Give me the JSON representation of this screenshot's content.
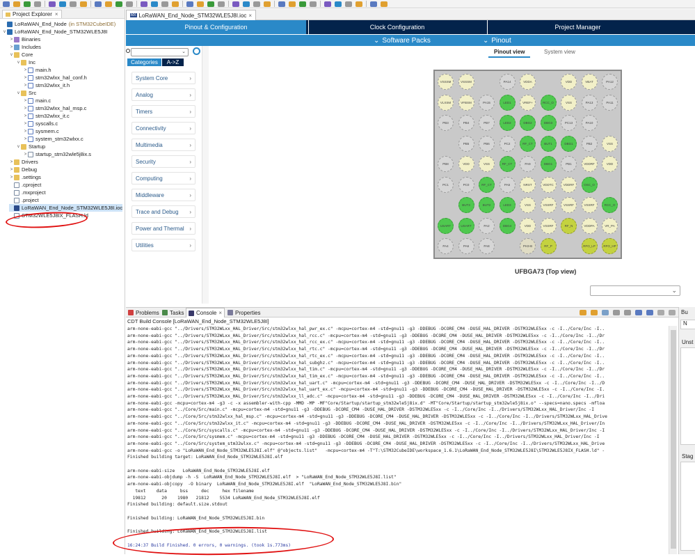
{
  "explorer": {
    "title": "Project Explorer",
    "tree": [
      {
        "label": "LoRaWAN_End_Node",
        "suffix": "(in STM32CubeIDE)",
        "icon": "project-icon",
        "twisty": "",
        "depth": 0
      },
      {
        "label": "LoRaWAN_End_Node_STM32WLE5J8I",
        "icon": "project-icon",
        "twisty": "v",
        "depth": 0
      },
      {
        "label": "Binaries",
        "icon": "binaries-icon",
        "twisty": ">",
        "depth": 1
      },
      {
        "label": "Includes",
        "icon": "includes-icon",
        "twisty": ">",
        "depth": 1
      },
      {
        "label": "Core",
        "icon": "folder-icon",
        "twisty": "v",
        "depth": 1
      },
      {
        "label": "Inc",
        "icon": "folder-icon",
        "twisty": "v",
        "depth": 2
      },
      {
        "label": "main.h",
        "icon": "header-file-icon",
        "twisty": ">",
        "depth": 3
      },
      {
        "label": "stm32wlxx_hal_conf.h",
        "icon": "header-file-icon",
        "twisty": ">",
        "depth": 3
      },
      {
        "label": "stm32wlxx_it.h",
        "icon": "header-file-icon",
        "twisty": ">",
        "depth": 3
      },
      {
        "label": "Src",
        "icon": "folder-icon",
        "twisty": "v",
        "depth": 2
      },
      {
        "label": "main.c",
        "icon": "c-file-icon",
        "twisty": ">",
        "depth": 3
      },
      {
        "label": "stm32wlxx_hal_msp.c",
        "icon": "c-file-icon",
        "twisty": ">",
        "depth": 3
      },
      {
        "label": "stm32wlxx_it.c",
        "icon": "c-file-icon",
        "twisty": ">",
        "depth": 3
      },
      {
        "label": "syscalls.c",
        "icon": "c-file-icon",
        "twisty": ">",
        "depth": 3
      },
      {
        "label": "sysmem.c",
        "icon": "c-file-icon",
        "twisty": ">",
        "depth": 3
      },
      {
        "label": "system_stm32wlxx.c",
        "icon": "c-file-icon",
        "twisty": ">",
        "depth": 3
      },
      {
        "label": "Startup",
        "icon": "folder-icon",
        "twisty": "v",
        "depth": 2
      },
      {
        "label": "startup_stm32wle5j8ix.s",
        "icon": "asm-file-icon",
        "twisty": ">",
        "depth": 3
      },
      {
        "label": "Drivers",
        "icon": "folder-icon",
        "twisty": ">",
        "depth": 1
      },
      {
        "label": "Debug",
        "icon": "folder-icon",
        "twisty": ">",
        "depth": 1
      },
      {
        "label": ".settings",
        "icon": "folder-icon",
        "twisty": ">",
        "depth": 1
      },
      {
        "label": ".cproject",
        "icon": "file-icon",
        "twisty": "",
        "depth": 1
      },
      {
        "label": ".mxproject",
        "icon": "file-icon",
        "twisty": "",
        "depth": 1
      },
      {
        "label": ".project",
        "icon": "file-icon",
        "twisty": "",
        "depth": 1
      },
      {
        "label": "LoRaWAN_End_Node_STM32WLE5J8I.ioc",
        "icon": "ioc-file-icon",
        "twisty": "",
        "depth": 1,
        "selected": true
      },
      {
        "label": "STM32WLE5J8IX_FLASH.ld",
        "icon": "file-icon",
        "twisty": "",
        "depth": 1
      }
    ]
  },
  "editor": {
    "tab_label": "LoRaWAN_End_Node_STM32WLE5J8I.ioc",
    "tab_badge": "MX",
    "nav": [
      "Pinout & Configuration",
      "Clock Configuration",
      "Project Manager"
    ],
    "subnav": [
      "Software Packs",
      "Pinout"
    ],
    "subnav_chevron": "⌄",
    "categories_tab": "Categories",
    "az_tab": "A->Z",
    "categories": [
      "System Core",
      "Analog",
      "Timers",
      "Connectivity",
      "Multimedia",
      "Security",
      "Computing",
      "Middleware",
      "Trace and Debug",
      "Power and Thermal",
      "Utilities"
    ],
    "view_tabs": [
      "Pinout view",
      "System view"
    ],
    "chip_label": "UFBGA73 (Top view)"
  },
  "chip_pins": [
    [
      "VSSSM",
      "VSSSM",
      "",
      "PA14",
      "VDDA",
      "",
      "VDD",
      "VBAT",
      "PA12"
    ],
    [
      "VLXSM",
      "VFBSM",
      "PA15",
      "LED1",
      "VREF+",
      "RCC_O",
      "VSS",
      "PA13",
      "PA11"
    ],
    [
      "PB3",
      "PB4",
      "PB7",
      "LED2",
      "DBG2",
      "DBG3",
      "PC13",
      "PA10",
      ""
    ],
    [
      "",
      "PB5",
      "PB6",
      "PC2",
      "RF_CT",
      "BUT1",
      "DBG1",
      "PB2",
      "VSS"
    ],
    [
      "PB8",
      "VDD",
      "VSS",
      "RF_CT",
      "PA9",
      "DBG1",
      "PB1",
      "VDDRF",
      "VDD"
    ],
    [
      "PC1",
      "PC0",
      "RF_CT",
      "PA5",
      "NRST",
      "VDDTC",
      "VDDRF",
      "OSC_O",
      ""
    ],
    [
      "",
      "BUT3",
      "BUT2",
      "LED3",
      "VSS",
      "VSSRF",
      "VSSRF",
      "VSSRF",
      "RCC_O"
    ],
    [
      "USART",
      "USART",
      "PA2",
      "DBG4",
      "VDD",
      "VSSRF",
      "RF_N",
      "VDDPA",
      "VR_PA"
    ],
    [
      "PA4",
      "PA6",
      "PA8",
      "",
      "PH3-B",
      "RF_P",
      "",
      "RFO_LP",
      "RFO_HP"
    ]
  ],
  "chip_pin_types": [
    [
      "pwr",
      "pwr",
      "none",
      "gray",
      "pwr",
      "none",
      "pwr",
      "pwr",
      "gray"
    ],
    [
      "pwr",
      "pwr",
      "gray",
      "green",
      "pwr",
      "green",
      "pwr",
      "gray",
      "gray"
    ],
    [
      "gray",
      "gray",
      "gray",
      "green",
      "green",
      "green",
      "gray",
      "gray",
      "none"
    ],
    [
      "none",
      "gray",
      "gray",
      "gray",
      "green",
      "green",
      "green",
      "gray",
      "pwr"
    ],
    [
      "gray",
      "pwr",
      "pwr",
      "green",
      "gray",
      "green",
      "gray",
      "pwr",
      "pwr"
    ],
    [
      "gray",
      "gray",
      "green",
      "gray",
      "pwr",
      "pwr",
      "pwr",
      "green",
      "none"
    ],
    [
      "none",
      "green",
      "green",
      "green",
      "pwr",
      "pwr",
      "pwr",
      "pwr",
      "green"
    ],
    [
      "green",
      "green",
      "gray",
      "green",
      "pwr",
      "pwr",
      "olive",
      "pwr",
      "pwr"
    ],
    [
      "gray",
      "gray",
      "gray",
      "none",
      "pinkish",
      "olive",
      "none",
      "olive",
      "olive"
    ]
  ],
  "bottom": {
    "tabs": [
      "Problems",
      "Tasks",
      "Console",
      "Properties"
    ],
    "console_title": "CDT Build Console [LoRaWAN_End_Node_STM32WLE5J8I]",
    "lines": [
      "arm-none-eabi-gcc \"../Drivers/STM32WLxx_HAL_Driver/Src/stm32wlxx_hal_pwr_ex.c\" -mcpu=cortex-m4 -std=gnu11 -g3 -DDEBUG -DCORE_CM4 -DUSE_HAL_DRIVER -DSTM32WLE5xx -c -I../Core/Inc -I..",
      "arm-none-eabi-gcc \"../Drivers/STM32WLxx_HAL_Driver/Src/stm32wlxx_hal_rcc.c\" -mcpu=cortex-m4 -std=gnu11 -g3 -DDEBUG -DCORE_CM4 -DUSE_HAL_DRIVER -DSTM32WLE5xx -c -I../Core/Inc -I../Dr",
      "arm-none-eabi-gcc \"../Drivers/STM32WLxx_HAL_Driver/Src/stm32wlxx_hal_rcc_ex.c\" -mcpu=cortex-m4 -std=gnu11 -g3 -DDEBUG -DCORE_CM4 -DUSE_HAL_DRIVER -DSTM32WLE5xx -c -I../Core/Inc -I..",
      "arm-none-eabi-gcc \"../Drivers/STM32WLxx_HAL_Driver/Src/stm32wlxx_hal_rtc.c\" -mcpu=cortex-m4 -std=gnu11 -g3 -DDEBUG -DCORE_CM4 -DUSE_HAL_DRIVER -DSTM32WLE5xx -c -I../Core/Inc -I../Dr",
      "arm-none-eabi-gcc \"../Drivers/STM32WLxx_HAL_Driver/Src/stm32wlxx_hal_rtc_ex.c\" -mcpu=cortex-m4 -std=gnu11 -g3 -DDEBUG -DCORE_CM4 -DUSE_HAL_DRIVER -DSTM32WLE5xx -c -I../Core/Inc -I..",
      "arm-none-eabi-gcc \"../Drivers/STM32WLxx_HAL_Driver/Src/stm32wlxx_hal_subghz.c\" -mcpu=cortex-m4 -std=gnu11 -g3 -DDEBUG -DCORE_CM4 -DUSE_HAL_DRIVER -DSTM32WLE5xx -c -I../Core/Inc -I..",
      "arm-none-eabi-gcc \"../Drivers/STM32WLxx_HAL_Driver/Src/stm32wlxx_hal_tim.c\" -mcpu=cortex-m4 -std=gnu11 -g3 -DDEBUG -DCORE_CM4 -DUSE_HAL_DRIVER -DSTM32WLE5xx -c -I../Core/Inc -I../Dr",
      "arm-none-eabi-gcc \"../Drivers/STM32WLxx_HAL_Driver/Src/stm32wlxx_hal_tim_ex.c\" -mcpu=cortex-m4 -std=gnu11 -g3 -DDEBUG -DCORE_CM4 -DUSE_HAL_DRIVER -DSTM32WLE5xx -c -I../Core/Inc -I..",
      "arm-none-eabi-gcc \"../Drivers/STM32WLxx_HAL_Driver/Src/stm32wlxx_hal_uart.c\" -mcpu=cortex-m4 -std=gnu11 -g3 -DDEBUG -DCORE_CM4 -DUSE_HAL_DRIVER -DSTM32WLE5xx -c -I../Core/Inc -I../D",
      "arm-none-eabi-gcc \"../Drivers/STM32WLxx_HAL_Driver/Src/stm32wlxx_hal_uart_ex.c\" -mcpu=cortex-m4 -std=gnu11 -g3 -DDEBUG -DCORE_CM4 -DUSE_HAL_DRIVER -DSTM32WLE5xx -c -I../Core/Inc -I.",
      "arm-none-eabi-gcc \"../Drivers/STM32WLxx_HAL_Driver/Src/stm32wlxx_ll_adc.c\" -mcpu=cortex-m4 -std=gnu11 -g3 -DDEBUG -DCORE_CM4 -DUSE_HAL_DRIVER -DSTM32WLE5xx -c -I../Core/Inc -I../Dri",
      "arm-none-eabi-gcc -mcpu=cortex-m4 -g3 -c -x assembler-with-cpp -MMD -MP -MF\"Core/Startup/startup_stm32wle5j8ix.d\" -MT\"Core/Startup/startup_stm32wle5j8ix.o\" --specs=nano.specs -mfloa",
      "arm-none-eabi-gcc \"../Core/Src/main.c\" -mcpu=cortex-m4 -std=gnu11 -g3 -DDEBUG -DCORE_CM4 -DUSE_HAL_DRIVER -DSTM32WLE5xx -c -I../Core/Inc -I../Drivers/STM32WLxx_HAL_Driver/Inc -I",
      "arm-none-eabi-gcc \"../Core/Src/stm32wlxx_hal_msp.c\" -mcpu=cortex-m4 -std=gnu11 -g3 -DDEBUG -DCORE_CM4 -DUSE_HAL_DRIVER -DSTM32WLE5xx -c -I../Core/Inc -I../Drivers/STM32WLxx_HAL_Drive",
      "arm-none-eabi-gcc \"../Core/Src/stm32wlxx_it.c\" -mcpu=cortex-m4 -std=gnu11 -g3 -DDEBUG -DCORE_CM4 -DUSE_HAL_DRIVER -DSTM32WLE5xx -c -I../Core/Inc -I../Drivers/STM32WLxx_HAL_Driver/In",
      "arm-none-eabi-gcc \"../Core/Src/syscalls.c\" -mcpu=cortex-m4 -std=gnu11 -g3 -DDEBUG -DCORE_CM4 -DUSE_HAL_DRIVER -DSTM32WLE5xx -c -I../Core/Inc -I../Drivers/STM32WLxx_HAL_Driver/Inc -I",
      "arm-none-eabi-gcc \"../Core/Src/sysmem.c\" -mcpu=cortex-m4 -std=gnu11 -g3 -DDEBUG -DCORE_CM4 -DUSE_HAL_DRIVER -DSTM32WLE5xx -c -I../Core/Inc -I../Drivers/STM32WLxx_HAL_Driver/Inc -I",
      "arm-none-eabi-gcc \"../Core/Src/system_stm32wlxx.c\" -mcpu=cortex-m4 -std=gnu11 -g3 -DDEBUG -DCORE_CM4 -DUSE_HAL_DRIVER -DSTM32WLE5xx -c -I../Core/Inc -I../Drivers/STM32WLxx_HAL_Drive",
      "arm-none-eabi-gcc -o \"LoRaWAN_End_Node_STM32WLE5J8I.elf\" @\"objects.list\"   -mcpu=cortex-m4 -T\"T:\\STM32CubeIDE\\workspace_1.6.1\\LoRaWAN_End_Node_STM32WLE5J8I\\STM32WLE5J8IX_FLASH.ld\" -",
      "Finished building target: LoRaWAN_End_Node_STM32WLE5J8I.elf",
      "",
      "arm-none-eabi-size   LoRaWAN_End_Node_STM32WLE5J8I.elf",
      "arm-none-eabi-objdump -h -S  LoRaWAN_End_Node_STM32WLE5J8I.elf  > \"LoRaWAN_End_Node_STM32WLE5J8I.list\"",
      "arm-none-eabi-objcopy  -O binary  LoRaWAN_End_Node_STM32WLE5J8I.elf  \"LoRaWAN_End_Node_STM32WLE5J8I.bin\"",
      "   text    data     bss     dec     hex filename",
      "  19812      20    1980   21812    5534 LoRaWAN_End_Node_STM32WLE5J8I.elf",
      "Finished building: default.size.stdout",
      "",
      "Finished building: LoRaWAN_End_Node_STM32WLE5J8I.bin",
      "",
      "Finished building: LoRaWAN_End_Node_STM32WLE5J8I.list",
      ""
    ],
    "summary": "16:24:37 Build Finished. 0 errors, 0 warnings. (took 1s.773ms)"
  },
  "right_panel": {
    "top_letters": "Bu",
    "row2": "N",
    "label1": "Unst",
    "label2": "Stag"
  },
  "colors": {
    "nav_bg": "#03234b",
    "nav_active": "#2a89c8",
    "pin_green": "#4fc84f",
    "pin_power": "#f2f0c8",
    "pin_gray": "#d6d6d6",
    "annotation_red": "#e01010"
  }
}
